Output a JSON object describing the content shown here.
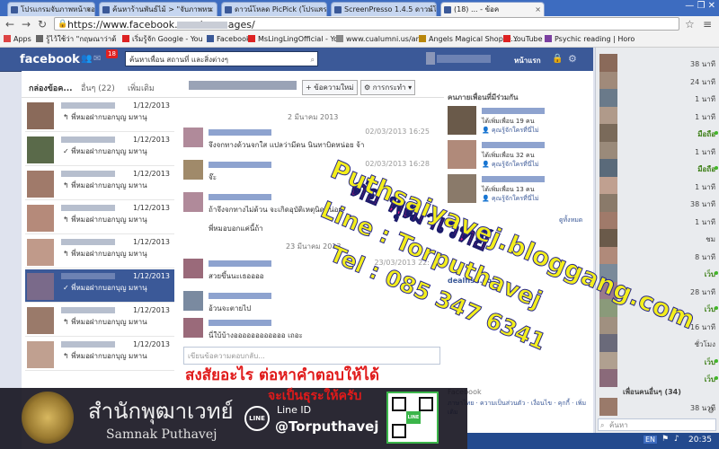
{
  "browser": {
    "tabs": [
      {
        "label": "โปรแกรมจับภาพหน้าจอ แคปเจ"
      },
      {
        "label": "ค้นหาร้านพันธ์ไม้ > \"จับภาพหน"
      },
      {
        "label": "ดาวน์โหลด PicPick (โปรแกรม"
      },
      {
        "label": "ScreenPresso 1.4.5 ดาวน์โหล"
      },
      {
        "label": "(18) ... - ข้อค"
      }
    ],
    "window_controls": "— ❐ ✕",
    "url": "https://www.facebook.com/messages/",
    "bookmarks": [
      {
        "label": "Apps"
      },
      {
        "label": "รู้ไว้ใช้ว่า \"กฤษณาว่าด้"
      },
      {
        "label": "เริ่มรู้จัก Google - You"
      },
      {
        "label": "Facebook"
      },
      {
        "label": "MsLingLingOfficial - Yo"
      },
      {
        "label": "www.cualumni.us/arti"
      },
      {
        "label": "Angels Magical Shop O..."
      },
      {
        "label": "YouTube"
      },
      {
        "label": "Psychic reading | Horo"
      }
    ]
  },
  "fb": {
    "logo": "facebook",
    "notif_count": "18",
    "search_placeholder": "ค้นหาเพื่อน สถานที่ และสิ่งต่างๆ",
    "home": "หน้าแรก",
    "inbox_label": "กล่องข้อค...",
    "other_label": "อื่นๆ (22)",
    "more_label": "เพิ่มเติม",
    "new_msg_btn": "+ ข้อความใหม่",
    "actions_btn": "⚙ การกระทำ ▾",
    "conversations": [
      {
        "date": "1/12/2013",
        "preview": "↰ พี่หมอฝากบอกบุญ มหานุ"
      },
      {
        "date": "1/12/2013",
        "preview": "✓ พี่หมอฝากบอกบุญ มหานุ"
      },
      {
        "date": "1/12/2013",
        "preview": "↰ พี่หมอฝากบอกบุญ มหาน"
      },
      {
        "date": "1/12/2013",
        "preview": "↰ พี่หมอฝากบอกบุญ มหานุ"
      },
      {
        "date": "1/12/2013",
        "preview": "↰ พี่หมอฝากบอกบุญ มหานุ"
      },
      {
        "date": "1/12/2013",
        "preview": "✓ พี่หมอฝากบอกบุญ มหานุ"
      },
      {
        "date": "1/12/2013",
        "preview": "↰ พี่หมอฝากบอกบุญ มหาน"
      },
      {
        "date": "1/12/2013",
        "preview": "↰ พี่หมอฝากบอกบุญ มหาน"
      }
    ],
    "date_sep_1": "2 มีนาคม 2013",
    "date_sep_2": "23 มีนาคม 2013",
    "messages": [
      {
        "text": "จึงจกทางด้วนจกใส แปลว่ามีดน นินทาบิดหน่อย จ้า",
        "time": "02/03/2013 16:25"
      },
      {
        "text": "จ๊ะ",
        "time": "02/03/2013 16:28"
      },
      {
        "text": "ถ้าจึงจกทางไม่ด้วน จะเกิดอุบัติเหตุนิดหน่อย",
        "time": ""
      },
      {
        "text": "พี่หมอบอกแค่นี้ถ้า",
        "time": ""
      },
      {
        "text": "สวยขึ้นนะเธออออ",
        "time": "23/03/2013 22:"
      },
      {
        "text": "อ้วนจะตายไป",
        "time": ""
      },
      {
        "text": "นี่ใบ้บ้างออออออออออออ เถอะ",
        "time": ""
      }
    ],
    "composer_placeholder": "เขียนข้อความตอบกลับ...",
    "right": {
      "mutual_title": "คนภายเพื่อนที่มีร่วมกัน",
      "mutual_items": [
        {
          "line1": "ได้เพิ่มเพื่อน 19 คน",
          "line2": "👤 คุณรู้จักใครที่นี่ไม่"
        },
        {
          "line1": "ได้เพิ่มเพื่อน 32 คน",
          "line2": "👤 คุณรู้จักใครที่นี่ไม่"
        },
        {
          "line1": "ได้เพิ่มเพื่อน 13 คน",
          "line2": "👤 คุณรู้จักใครที่นี่ไม่"
        }
      ],
      "see_all": "ดูทั้งหมด",
      "page_name": "dealfish.co",
      "footer": "Facebook",
      "footer_links": "ภาษาไทย · ความเป็นส่วนตัว · เงื่อนไข · คุกกี้ · เพิ่มเติม"
    },
    "chat": {
      "rows": [
        {
          "status": "38 นาที"
        },
        {
          "status": "24 นาที"
        },
        {
          "status": "1 นาที"
        },
        {
          "status": "1 นาที"
        },
        {
          "status": "มือถือ",
          "online": true
        },
        {
          "status": "1 นาที"
        },
        {
          "status": "มือถือ",
          "online": true
        },
        {
          "status": "1 นาที"
        },
        {
          "status": "38 นาที"
        },
        {
          "status": "1 นาที"
        },
        {
          "status": "ชม"
        },
        {
          "status": "8 นาที"
        },
        {
          "status": "เว็บ",
          "online": true
        },
        {
          "status": "28 นาที"
        },
        {
          "status": "เว็บ",
          "online": true
        },
        {
          "status": "16 นาที"
        },
        {
          "status": "ชั่วโมง"
        },
        {
          "status": "เว็บ",
          "online": true
        },
        {
          "status": "เว็บ",
          "online": true
        }
      ],
      "more_friends": "เพื่อนคนอื่นๆ (34)",
      "more_row_status": "38 นาที",
      "search_placeholder": "ค้นหา"
    }
  },
  "overlay": {
    "watermark_1": "Puthsaiyavej.bloggang.com",
    "watermark_2": "Line : Torputhavej",
    "watermark_3": "Tel : 085 347 6341",
    "watermark_4": "ต่อ พุฒาเวทย์",
    "promo_1": "สงสัยอะไร ต่อหาคำตอบให้ได้",
    "promo_2": "จะเป็นธุระให้ครับ",
    "brand_th": "สำนักพุฒาเวทย์",
    "brand_en": "Samnak Puthavej",
    "line_badge": "LINE",
    "line_id_label": "Line ID",
    "line_id": "@Torputhavej",
    "qr_label": "LINE"
  },
  "taskbar": {
    "lang": "EN",
    "clock": "20:35"
  }
}
